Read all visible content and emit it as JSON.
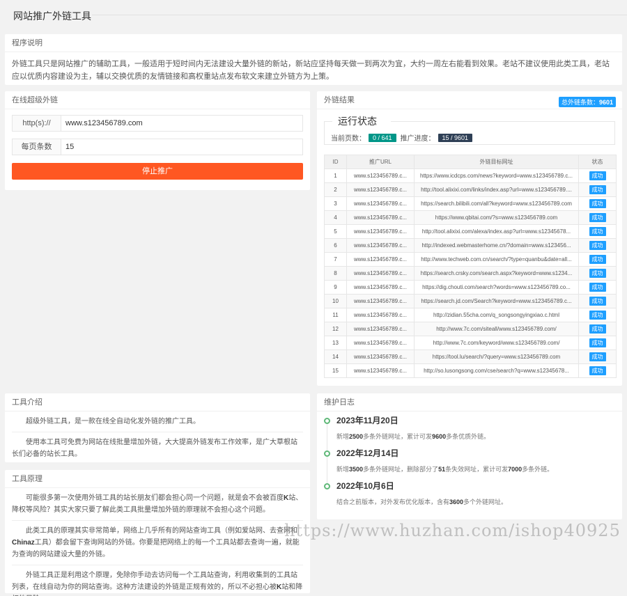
{
  "page": {
    "title": "网站推广外链工具"
  },
  "intro": {
    "heading": "程序说明",
    "text": "外链工具只是网站推广的辅助工具，一般适用于短时间内无法建设大量外链的新站，新站应坚持每天做一到两次为宜，大约一周左右能看到效果。老站不建议使用此类工具，老站应以优质内容建设为主，辅以交换优质的友情链接和高权重站点发布软文来建立外链方为上策。"
  },
  "form": {
    "heading": "在线超级外链",
    "protocol_label": "http(s)://",
    "url_value": "www.s123456789.com",
    "per_page_label": "每页条数",
    "per_page_value": "15",
    "stop_button": "停止推广"
  },
  "results": {
    "heading": "外链结果",
    "total_label": "总外链条数：",
    "total_value": "9601",
    "status_title": "运行状态",
    "current_page_label": "当前页数：",
    "current_page_value": "0 / 641",
    "progress_label": "推广进度：",
    "progress_value": "15 / 9601",
    "columns": [
      "ID",
      "推广URL",
      "外链目标网址",
      "状态"
    ],
    "rows": [
      {
        "id": "1",
        "url": "www.s123456789.c...",
        "target": "https://www.icdcps.com/news?keyword=www.s123456789.c...",
        "status": "成功"
      },
      {
        "id": "2",
        "url": "www.s123456789.c...",
        "target": "http://tool.alixixi.com/links/index.asp?url=www.s123456789....",
        "status": "成功"
      },
      {
        "id": "3",
        "url": "www.s123456789.c...",
        "target": "https://search.bilibili.com/all?keyword=www.s123456789.com",
        "status": "成功"
      },
      {
        "id": "4",
        "url": "www.s123456789.c...",
        "target": "https://www.qbitai.com/?s=www.s123456789.com",
        "status": "成功"
      },
      {
        "id": "5",
        "url": "www.s123456789.c...",
        "target": "http://tool.alixixi.com/alexa/index.asp?url=www.s12345678...",
        "status": "成功"
      },
      {
        "id": "6",
        "url": "www.s123456789.c...",
        "target": "http://indexed.webmasterhome.cn/?domain=www.s123456...",
        "status": "成功"
      },
      {
        "id": "7",
        "url": "www.s123456789.c...",
        "target": "http://www.techweb.com.cn/search/?type=quanbu&date=all...",
        "status": "成功"
      },
      {
        "id": "8",
        "url": "www.s123456789.c...",
        "target": "https://search.crsky.com/search.aspx?keyword=www.s1234...",
        "status": "成功"
      },
      {
        "id": "9",
        "url": "www.s123456789.c...",
        "target": "https://dig.chouti.com/search?words=www.s123456789.co...",
        "status": "成功"
      },
      {
        "id": "10",
        "url": "www.s123456789.c...",
        "target": "https://search.jd.com/Search?keyword=www.s123456789.c...",
        "status": "成功"
      },
      {
        "id": "11",
        "url": "www.s123456789.c...",
        "target": "http://zidian.55cha.com/q_songsongyingxiao.c.html",
        "status": "成功"
      },
      {
        "id": "12",
        "url": "www.s123456789.c...",
        "target": "http://www.7c.com/siteall/www.s123456789.com/",
        "status": "成功"
      },
      {
        "id": "13",
        "url": "www.s123456789.c...",
        "target": "http://www.7c.com/keyword/www.s123456789.com/",
        "status": "成功"
      },
      {
        "id": "14",
        "url": "www.s123456789.c...",
        "target": "https://tool.lu/search/?query=www.s123456789.com",
        "status": "成功"
      },
      {
        "id": "15",
        "url": "www.s123456789.c...",
        "target": "http://so.lusongsong.com/cse/search?q=www.s12345678...",
        "status": "成功"
      }
    ]
  },
  "tool_intro": {
    "heading": "工具介绍",
    "paragraphs": [
      "超级外链工具，是一款在线全自动化发外链的推广工具。",
      "使用本工具可免费为网站在线批量增加外链，大大提高外链发布工作效率，是广大草根站长们必备的站长工具。"
    ]
  },
  "principle": {
    "heading": "工具原理",
    "p1_a": "可能很多第一次使用外链工具的站长朋友们都会担心同一个问题，就是会不会被百度",
    "p1_k": "K",
    "p1_b": "站、降权等风险？其实大家只要了解此类工具批量增加外链的原理就不会担心这个问题。",
    "p2_a": "此类工具的原理其实非常简单，网络上几乎所有的网站查询工具（例如爱站网、去查网和",
    "p2_chinaz": "Chinaz",
    "p2_b": "工具）都会留下查询网站的外链。你要是把网络上的每一个工具站都去查询一遍，就能为查询的网站建设大量的外链。",
    "p3_a": "外链工具正是利用这个原理，免除你手动去访问每一个工具站查询，利用收集到的工具站列表，在线自动为你的网站查询。这种方法建设的外链是正规有效的，所以不必担心被",
    "p3_k": "K",
    "p3_b": "站和降权的风险。"
  },
  "changelog": {
    "heading": "维护日志",
    "items": [
      {
        "date": "2023年11月20日",
        "d1": "新增",
        "n1": "2500",
        "d2": "多条外链网址，累计可发",
        "n2": "9600",
        "d3": "多条优质外链。"
      },
      {
        "date": "2022年12月14日",
        "d1": "新增",
        "n1": "3500",
        "d2": "多条外链网址，删除部分了",
        "n2": "51",
        "d3": "条失效网址，累计可发",
        "n3": "7000",
        "d4": "多条外链。"
      },
      {
        "date": "2022年10月6日",
        "d1": "结合之前版本，对外发布优化版本，含有",
        "n1": "3600",
        "d2": "多个外链网址。"
      }
    ]
  },
  "watermark": "https://www.huzhan.com/ishop40925"
}
